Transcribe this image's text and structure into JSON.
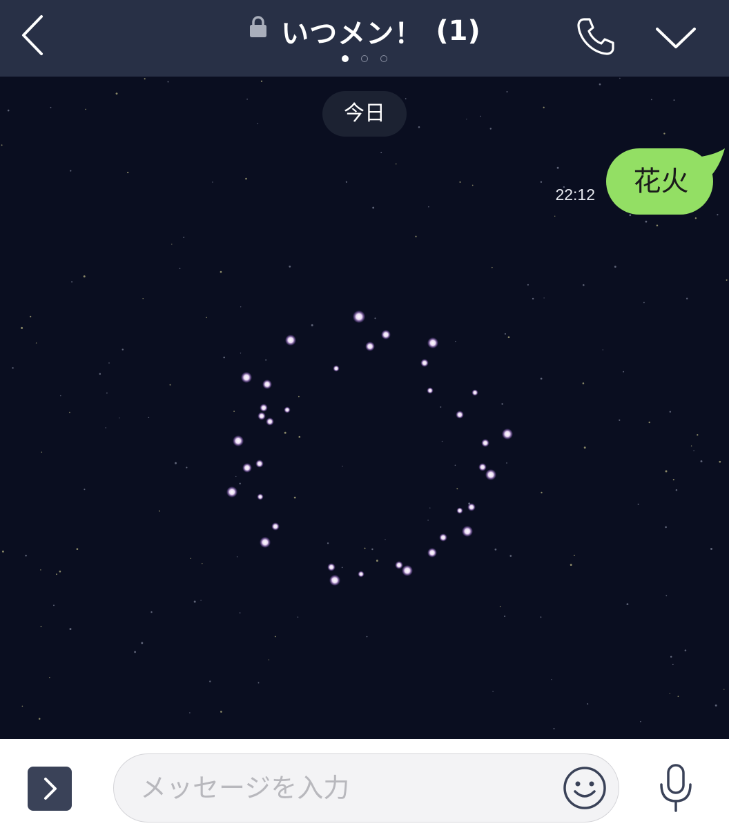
{
  "header": {
    "title": "いつメン！",
    "member_count": "(1)",
    "back_icon": "chevron-left-icon",
    "lock_icon": "lock-icon",
    "call_icon": "phone-icon",
    "menu_icon": "chevron-down-icon",
    "page_indicator": {
      "total": 3,
      "active": 1
    }
  },
  "chat": {
    "date_label": "今日",
    "messages": [
      {
        "sender": "me",
        "text": "花火",
        "time": "22:12"
      }
    ],
    "effect": "fireworks-effect"
  },
  "input_bar": {
    "expand_icon": "chevron-right-icon",
    "placeholder": "メッセージを入力",
    "value": "",
    "emoji_icon": "smiley-icon",
    "mic_icon": "microphone-icon"
  },
  "colors": {
    "header_bg": "#283046",
    "chat_bg": "#0a0e20",
    "bubble_green": "#93df64",
    "firework_glow": "#e6b8ff"
  }
}
